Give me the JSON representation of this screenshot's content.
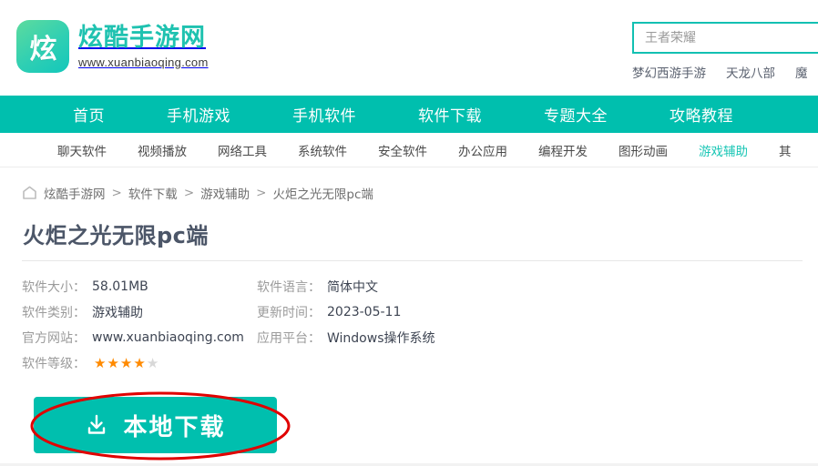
{
  "site": {
    "logo_glyph": "炫",
    "name": "炫酷手游网",
    "url": "www.xuanbiaoqing.com",
    "logo_icon_name": "site-logo-icon"
  },
  "search": {
    "placeholder": "王者荣耀",
    "value": ""
  },
  "hotwords": [
    {
      "label": "梦幻西游手游"
    },
    {
      "label": "天龙八部"
    },
    {
      "label": "魔"
    }
  ],
  "mainnav": [
    {
      "label": "首页"
    },
    {
      "label": "手机游戏"
    },
    {
      "label": "手机软件"
    },
    {
      "label": "软件下载"
    },
    {
      "label": "专题大全"
    },
    {
      "label": "攻略教程"
    }
  ],
  "subnav": [
    {
      "label": "聊天软件",
      "active": false
    },
    {
      "label": "视频播放",
      "active": false
    },
    {
      "label": "网络工具",
      "active": false
    },
    {
      "label": "系统软件",
      "active": false
    },
    {
      "label": "安全软件",
      "active": false
    },
    {
      "label": "办公应用",
      "active": false
    },
    {
      "label": "编程开发",
      "active": false
    },
    {
      "label": "图形动画",
      "active": false
    },
    {
      "label": "游戏辅助",
      "active": true
    },
    {
      "label": "其",
      "active": false
    }
  ],
  "breadcrumb": {
    "home_icon_name": "home-icon",
    "items": [
      "炫酷手游网",
      "软件下载",
      "游戏辅助",
      "火炬之光无限pc端"
    ],
    "separator": ">"
  },
  "page": {
    "title": "火炬之光无限pc端"
  },
  "meta": {
    "rows": [
      {
        "l1": "软件大小：",
        "v1": "58.01MB",
        "l2": "软件语言：",
        "v2": "简体中文"
      },
      {
        "l1": "软件类别：",
        "v1": "游戏辅助",
        "l2": "更新时间：",
        "v2": "2023-05-11"
      },
      {
        "l1": "官方网站：",
        "v1": "www.xuanbiaoqing.com",
        "l2": "应用平台：",
        "v2": "Windows操作系统"
      }
    ],
    "rating_label": "软件等级：",
    "rating_filled": 4,
    "rating_total": 5
  },
  "download": {
    "label": "本地下载",
    "icon_name": "download-icon"
  },
  "colors": {
    "teal": "#00bfae",
    "teal_text": "#19c6b5",
    "annotation_red": "#e00000",
    "star_on": "#ff8a00",
    "star_off": "#d8d8d8",
    "title": "#4c5668"
  }
}
